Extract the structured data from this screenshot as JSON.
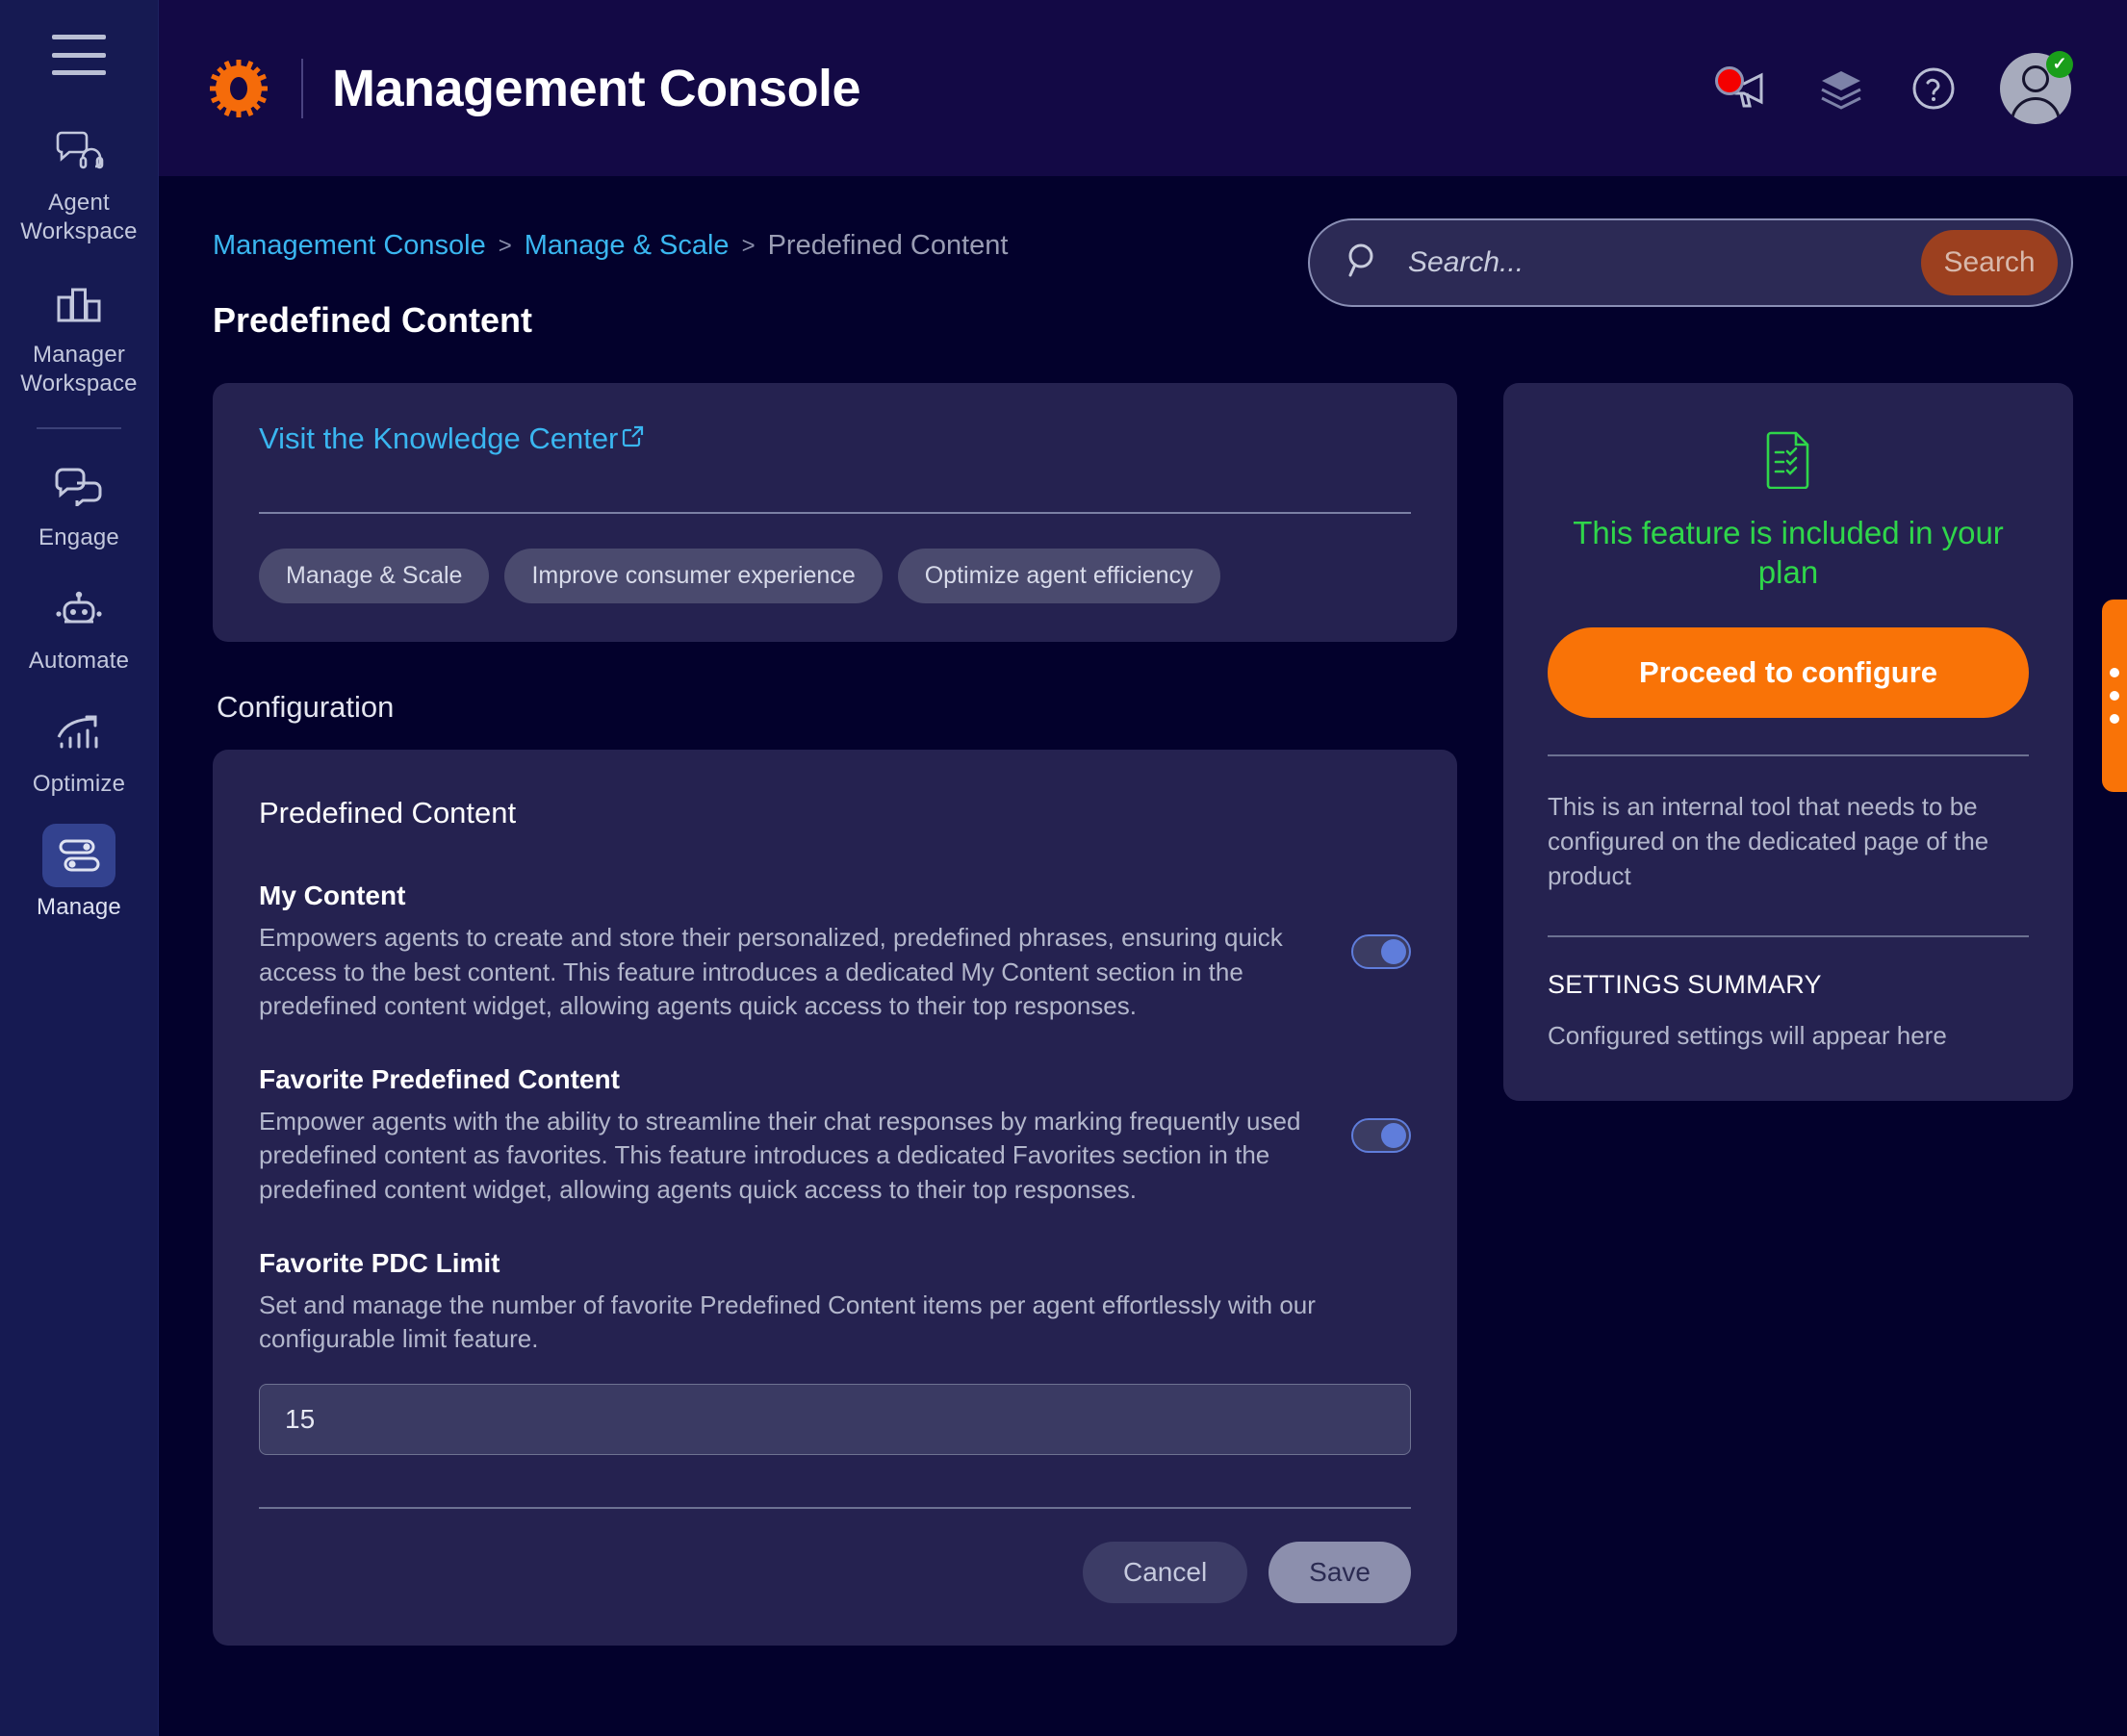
{
  "header": {
    "title": "Management Console",
    "logo_icon": "gear-icon",
    "announcements_icon": "megaphone-icon",
    "layers_icon": "layers-icon",
    "help_icon": "help-circle-icon",
    "avatar_icon": "user-avatar",
    "avatar_badge": "✓"
  },
  "sidebar": {
    "menu_icon": "hamburger-menu-icon",
    "items": [
      {
        "label": "Agent Workspace",
        "icon": "headset-chat-icon",
        "active": false
      },
      {
        "label": "Manager Workspace",
        "icon": "bar-chart-icon",
        "active": false
      },
      {
        "label": "Engage",
        "icon": "chat-bubbles-icon",
        "active": false
      },
      {
        "label": "Automate",
        "icon": "robot-icon",
        "active": false
      },
      {
        "label": "Optimize",
        "icon": "trending-up-chart-icon",
        "active": false
      },
      {
        "label": "Manage",
        "icon": "sliders-icon",
        "active": true
      }
    ]
  },
  "breadcrumb": {
    "items": [
      "Management Console",
      "Manage & Scale",
      "Predefined Content"
    ],
    "separator": ">"
  },
  "page": {
    "title": "Predefined Content"
  },
  "search": {
    "placeholder": "Search...",
    "value": "",
    "button_label": "Search",
    "icon": "search-magnifier-icon"
  },
  "knowledge_card": {
    "link_label": "Visit the Knowledge Center",
    "link_icon": "external-link-icon",
    "tags": [
      "Manage & Scale",
      "Improve consumer experience",
      "Optimize agent efficiency"
    ]
  },
  "configuration": {
    "section_label": "Configuration",
    "card_title": "Predefined Content",
    "settings": [
      {
        "name": "My Content",
        "description": "Empowers agents to create and store their personalized, predefined phrases, ensuring quick access to the best content. This feature introduces a dedicated My Content section in the predefined content widget, allowing agents quick access to their top responses.",
        "toggle_state": "on"
      },
      {
        "name": "Favorite Predefined Content",
        "description": "Empower agents with the ability to streamline their chat responses by marking frequently used predefined content as favorites. This feature introduces a dedicated Favorites section in the predefined content widget, allowing agents quick access to their top responses.",
        "toggle_state": "on"
      }
    ],
    "limit_field": {
      "name": "Favorite PDC Limit",
      "description": "Set and manage the number of favorite Predefined Content items per agent effortlessly with our configurable limit feature.",
      "value": "15"
    },
    "cancel_label": "Cancel",
    "save_label": "Save"
  },
  "plan_panel": {
    "status_icon": "document-check-icon",
    "status_message": "This feature is included in your plan",
    "cta_label": "Proceed to configure",
    "note": "This is an internal tool that needs to be configured on the dedicated page of the product",
    "summary_heading": "SETTINGS SUMMARY",
    "summary_body": "Configured settings will appear here"
  },
  "edge_tab": {
    "icon": "more-dots-icon"
  },
  "colors": {
    "accent_orange": "#f97307",
    "link_blue": "#3ab6f0",
    "success_green": "#2fd64a",
    "card_bg": "#252250",
    "page_bg": "#03012c",
    "header_bg": "#130945",
    "sidebar_bg": "#161a52",
    "toggle_on": "#5f7ddb",
    "notification_red": "#f40000"
  }
}
